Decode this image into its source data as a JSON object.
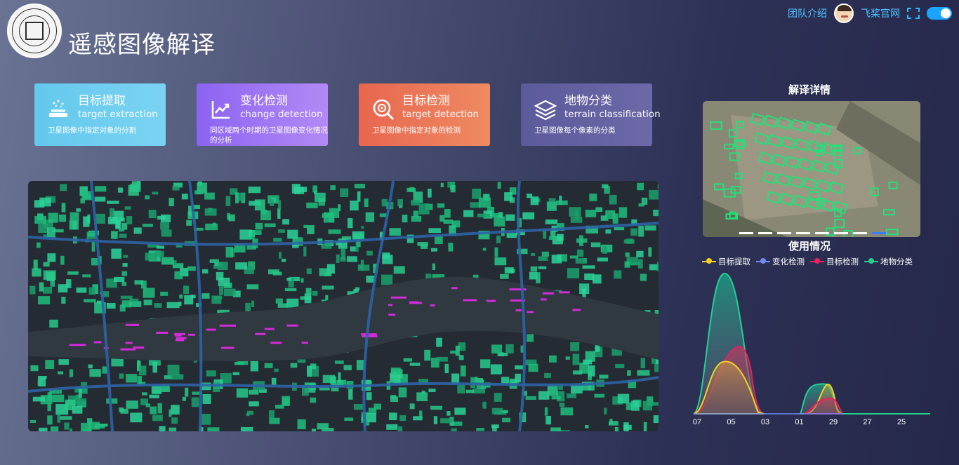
{
  "header": {
    "title": "遥感图像解译",
    "nav": {
      "team": "团队介绍",
      "paddle": "飞桨官网"
    }
  },
  "cards": [
    {
      "title": "目标提取",
      "subtitle": "target extraction",
      "desc": "卫星图像中指定对象的分割",
      "icon": "extraction-icon"
    },
    {
      "title": "变化检测",
      "subtitle": "change detection",
      "desc": "同区域两个时期的卫星图像变化情况的分析",
      "icon": "trend-chart-icon"
    },
    {
      "title": "目标检测",
      "subtitle": "target detection",
      "desc": "卫星图像中指定对象的检测",
      "icon": "search-target-icon"
    },
    {
      "title": "地物分类",
      "subtitle": "terrain classification",
      "desc": "卫星图像每个像素的分类",
      "icon": "layers-icon"
    }
  ],
  "detail": {
    "title": "解译详情"
  },
  "usage": {
    "title": "使用情况"
  },
  "chart_data": {
    "type": "area",
    "x": [
      "07",
      "05",
      "03",
      "01",
      "29",
      "27",
      "25"
    ],
    "series": [
      {
        "name": "目标提取",
        "color": "#f5d21f"
      },
      {
        "name": "变化检测",
        "color": "#6f8cf3"
      },
      {
        "name": "目标检测",
        "color": "#e5225f"
      },
      {
        "name": "地物分类",
        "color": "#25d08e"
      }
    ],
    "legend": "top",
    "grid": false
  }
}
